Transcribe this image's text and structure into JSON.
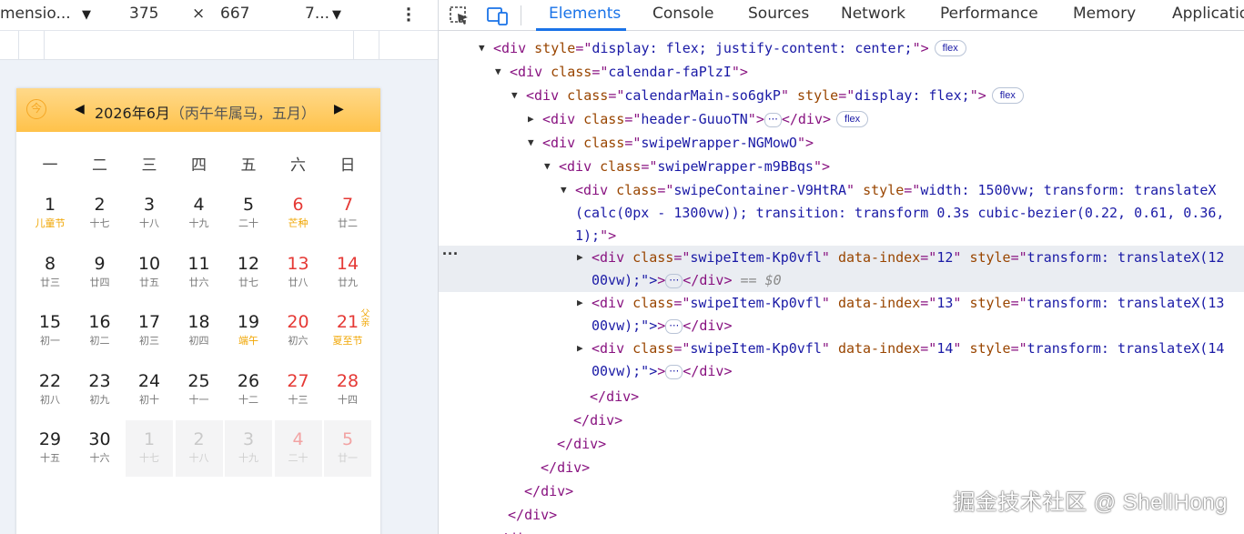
{
  "toolbar": {
    "dimensions_label": "mensio...",
    "width": "375",
    "times": "×",
    "height": "667",
    "zoom": "7..."
  },
  "calendar": {
    "today_icon": "今",
    "title_main": "2026年6月",
    "title_lunar": "（丙午年属马，五月）",
    "weekdays": [
      "一",
      "二",
      "三",
      "四",
      "五",
      "六",
      "日"
    ],
    "weeks": [
      [
        {
          "num": "1",
          "sub": "儿童节",
          "fest": true
        },
        {
          "num": "2",
          "sub": "十七"
        },
        {
          "num": "3",
          "sub": "十八"
        },
        {
          "num": "4",
          "sub": "十九"
        },
        {
          "num": "5",
          "sub": "二十"
        },
        {
          "num": "6",
          "sub": "芒种",
          "wk": true,
          "fest": true
        },
        {
          "num": "7",
          "sub": "廿二",
          "wk": true
        }
      ],
      [
        {
          "num": "8",
          "sub": "廿三"
        },
        {
          "num": "9",
          "sub": "廿四"
        },
        {
          "num": "10",
          "sub": "廿五"
        },
        {
          "num": "11",
          "sub": "廿六"
        },
        {
          "num": "12",
          "sub": "廿七"
        },
        {
          "num": "13",
          "sub": "廿八",
          "wk": true
        },
        {
          "num": "14",
          "sub": "廿九",
          "wk": true
        }
      ],
      [
        {
          "num": "15",
          "sub": "初一"
        },
        {
          "num": "16",
          "sub": "初二"
        },
        {
          "num": "17",
          "sub": "初三"
        },
        {
          "num": "18",
          "sub": "初四"
        },
        {
          "num": "19",
          "sub": "端午",
          "fest": true
        },
        {
          "num": "20",
          "sub": "初六",
          "wk": true
        },
        {
          "num": "21",
          "sub": "夏至节",
          "side": "父亲",
          "wk": true,
          "fest": true
        }
      ],
      [
        {
          "num": "22",
          "sub": "初八"
        },
        {
          "num": "23",
          "sub": "初九"
        },
        {
          "num": "24",
          "sub": "初十"
        },
        {
          "num": "25",
          "sub": "十一"
        },
        {
          "num": "26",
          "sub": "十二"
        },
        {
          "num": "27",
          "sub": "十三",
          "wk": true
        },
        {
          "num": "28",
          "sub": "十四",
          "wk": true
        }
      ],
      [
        {
          "num": "29",
          "sub": "十五"
        },
        {
          "num": "30",
          "sub": "十六"
        },
        {
          "num": "1",
          "sub": "十七",
          "other": true
        },
        {
          "num": "2",
          "sub": "十八",
          "other": true
        },
        {
          "num": "3",
          "sub": "十九",
          "other": true
        },
        {
          "num": "4",
          "sub": "二十",
          "other": true,
          "wk": true
        },
        {
          "num": "5",
          "sub": "廿一",
          "other": true,
          "wk": true
        }
      ]
    ]
  },
  "devtools": {
    "tabs": [
      "Elements",
      "Console",
      "Sources",
      "Network",
      "Performance",
      "Memory",
      "Applicatio"
    ],
    "active_tab": "Elements",
    "badges": {
      "flex": "flex",
      "ellipsis": "⋯"
    },
    "selected_marker": "== $0",
    "lines": [
      {
        "tag": "div",
        "attrs": [
          [
            "style",
            "display: flex; justify-content: center;"
          ]
        ],
        "badge": "flex"
      },
      {
        "tag": "div",
        "attrs": [
          [
            "class",
            "calendar-faPlzI"
          ]
        ]
      },
      {
        "tag": "div",
        "attrs": [
          [
            "class",
            "calendarMain-so6gkP"
          ],
          [
            "style",
            "display: flex;"
          ]
        ],
        "badge": "flex"
      },
      {
        "tag": "div",
        "attrs": [
          [
            "class",
            "header-GuuoTN"
          ]
        ],
        "collapsed": true,
        "badge": "flex"
      },
      {
        "tag": "div",
        "attrs": [
          [
            "class",
            "swipeWrapper-NGMowO"
          ]
        ]
      },
      {
        "tag": "div",
        "attrs": [
          [
            "class",
            "swipeWrapper-m9BBqs"
          ]
        ]
      },
      {
        "tag": "div",
        "attrs": [
          [
            "class",
            "swipeContainer-V9HtRA"
          ],
          [
            "style",
            "width: 1500vw; transform: translateX"
          ]
        ],
        "cont": "(calc(0px - 1300vw)); transition: transform 0.3s cubic-bezier(0.22, 0.61, 0.36,",
        "cont2": "1);\">"
      },
      {
        "tag": "div",
        "attrs": [
          [
            "class",
            "swipeItem-Kp0vfl"
          ],
          [
            "data-index",
            "12"
          ],
          [
            "style",
            "transform: translateX(12"
          ]
        ],
        "cont": "00vw);\">",
        "collapsed": true,
        "selected": true
      },
      {
        "tag": "div",
        "attrs": [
          [
            "class",
            "swipeItem-Kp0vfl"
          ],
          [
            "data-index",
            "13"
          ],
          [
            "style",
            "transform: translateX(13"
          ]
        ],
        "cont": "00vw);\">",
        "collapsed": true
      },
      {
        "tag": "div",
        "attrs": [
          [
            "class",
            "swipeItem-Kp0vfl"
          ],
          [
            "data-index",
            "14"
          ],
          [
            "style",
            "transform: translateX(14"
          ]
        ],
        "cont": "00vw);\">",
        "collapsed": true
      }
    ],
    "close_tag": "</div>"
  },
  "watermark": "掘金技术社区 @ ShellHong"
}
